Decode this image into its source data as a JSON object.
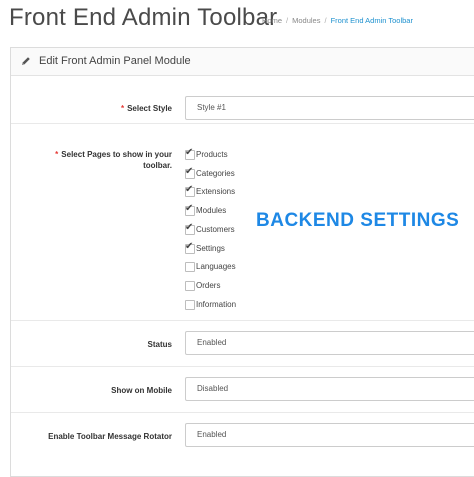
{
  "header": {
    "title": "Front End Admin Toolbar",
    "breadcrumbs": [
      "Home",
      "Modules",
      "Front End Admin Toolbar"
    ],
    "breadcrumb_separator": "/"
  },
  "panel": {
    "heading": "Edit Front Admin Panel Module",
    "icon": "pencil-icon"
  },
  "form": {
    "required_marker": "*",
    "select_style": {
      "label": "Select Style",
      "value": "Style #1"
    },
    "select_pages": {
      "label_line1": "Select Pages to show in your",
      "label_line2": "toolbar.",
      "items": [
        {
          "label": "Products",
          "checked": true
        },
        {
          "label": "Categories",
          "checked": true
        },
        {
          "label": "Extensions",
          "checked": true
        },
        {
          "label": "Modules",
          "checked": true
        },
        {
          "label": "Customers",
          "checked": true
        },
        {
          "label": "Settings",
          "checked": true
        },
        {
          "label": "Languages",
          "checked": false
        },
        {
          "label": "Orders",
          "checked": false
        },
        {
          "label": "Information",
          "checked": false
        }
      ]
    },
    "status": {
      "label": "Status",
      "value": "Enabled"
    },
    "show_on_mobile": {
      "label": "Show on Mobile",
      "value": "Disabled"
    },
    "message_rotator": {
      "label": "Enable Toolbar Message Rotator",
      "value": "Enabled"
    }
  },
  "promo_text": "BACKEND SETTINGS",
  "colors": {
    "accent": "#1e88e5",
    "link": "#1e91cf",
    "required": "#e53935"
  }
}
